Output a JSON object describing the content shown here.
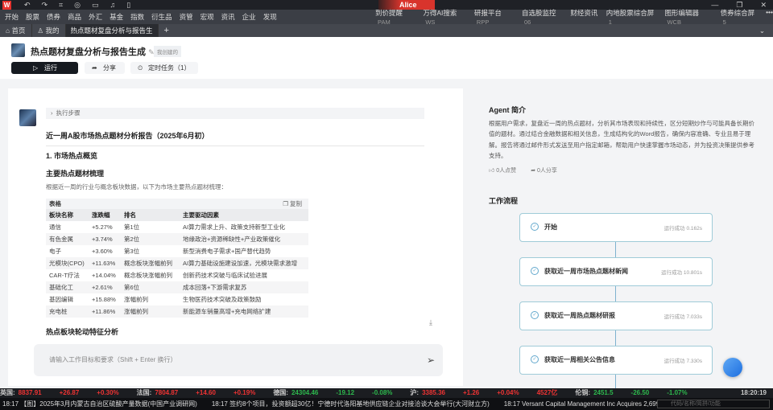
{
  "titlebar": {
    "logo": "W",
    "user": "Alice",
    "icons": [
      "undo-icon",
      "redo-icon",
      "crop-icon",
      "chat-icon",
      "monitor-icon",
      "bell-icon",
      "clipboard-icon"
    ]
  },
  "menu": {
    "left": [
      "开始",
      "股票",
      "债券",
      "商品",
      "外汇",
      "基金",
      "指数",
      "衍生品",
      "资管",
      "宏观",
      "资讯",
      "企业",
      "发现"
    ],
    "right": [
      {
        "label": "到价提醒",
        "code": "PAM"
      },
      {
        "label": "万得AI搜索",
        "code": "WS"
      },
      {
        "label": "研报平台",
        "code": "RPP"
      },
      {
        "label": "自选股监控",
        "code": "06"
      },
      {
        "label": "财经资讯",
        "code": ""
      },
      {
        "label": "内地股票综合屏",
        "code": "1"
      },
      {
        "label": "图形编辑器",
        "code": "WCB"
      },
      {
        "label": "债券综合屏",
        "code": "5"
      }
    ],
    "more": "•••"
  },
  "tabs": [
    {
      "label": "首页"
    },
    {
      "label": "我的"
    },
    {
      "label": "热点题材复盘分析与报告生"
    }
  ],
  "header": {
    "title": "热点题材复盘分析与报告生成",
    "badge": "我创建的",
    "run": "运行",
    "share": "分享",
    "schedule": "定时任务（1）"
  },
  "chat": {
    "steps": "执行步骤",
    "report_title": "近一周A股市场热点题材分析报告（2025年6月初）",
    "section1": "1. 市场热点概览",
    "sub1": "主要热点题材梳理",
    "intro": "根据近一周的行业与概念板块数据，以下为市场主要热点题材梳理：",
    "table": {
      "label": "表格",
      "copy": "复制",
      "headers": [
        "板块名称",
        "涨跌幅",
        "排名",
        "主要驱动因素"
      ],
      "rows": [
        [
          "通信",
          "+5.27%",
          "第1位",
          "AI算力需求上升、政策支持新型工业化"
        ],
        [
          "有色金属",
          "+3.74%",
          "第2位",
          "地缘政治+资源稀缺性+产业政策催化"
        ],
        [
          "电子",
          "+3.60%",
          "第3位",
          "新型消费电子需求+国产替代趋势"
        ],
        [
          "光模块(CPO)",
          "+11.63%",
          "概念板块涨幅前列",
          "AI算力基础设施建设加速，光模块需求激增"
        ],
        [
          "CAR-T疗法",
          "+14.04%",
          "概念板块涨幅前列",
          "创新药技术突破与临床试验进展"
        ],
        [
          "基础化工",
          "+2.61%",
          "第6位",
          "成本回落+下游需求复苏"
        ],
        [
          "基因编辑",
          "+15.88%",
          "涨幅前列",
          "生物医药技术突破及政策鼓励"
        ],
        [
          "充电桩",
          "+11.86%",
          "涨幅前列",
          "新能源车销量高增+充电网络扩建"
        ]
      ]
    },
    "sub2": "热点板块轮动特征分析",
    "input_placeholder": "请输入工作目标和要求（Shift + Enter 换行）"
  },
  "agent": {
    "title": "Agent 简介",
    "description": "根据用户需求，复盘近一周的热点题材，分析其市场表现和持续性，区分短期炒作与可能具备长期价值的题材。通过结合金融数据和相关信息，生成结构化的Word报告，确保内容准确、专业且易于理解。报告将通过邮件形式发送至用户指定邮箱，帮助用户快速掌握市场动态，并为投资决策提供参考支持。",
    "likes": "0人点赞",
    "shares": "0人分享"
  },
  "workflow": {
    "title": "工作流程",
    "nodes": [
      {
        "name": "开始",
        "status": "运行成功 0.162s"
      },
      {
        "name": "获取近一周市场热点题材新闻",
        "status": "运行成功 10.801s"
      },
      {
        "name": "获取近一周热点题材研报",
        "status": "运行成功 7.033s"
      },
      {
        "name": "获取近一周相关公告信息",
        "status": "运行成功 7.330s"
      }
    ]
  },
  "ticker": [
    {
      "name": "英国:",
      "value": "8837.91",
      "chg": "+26.87",
      "pct": "+0.30%",
      "dir": "up"
    },
    {
      "name": "法国:",
      "value": "7804.87",
      "chg": "+14.60",
      "pct": "+0.19%",
      "dir": "up"
    },
    {
      "name": "德国:",
      "value": "24304.46",
      "chg": "-19.12",
      "pct": "-0.08%",
      "dir": "dn"
    },
    {
      "name": "沪:",
      "value": "3385.36",
      "chg": "+1.26",
      "pct": "+0.04%",
      "extra": "4527亿",
      "dir": "up"
    },
    {
      "name": "伦铜:",
      "value": "2451.5",
      "chg": "-26.50",
      "pct": "-1.07%",
      "dir": "dn"
    }
  ],
  "clock": "18:20:19",
  "news": [
    "18:17 【图】2025年3月内蒙古自治区硫酸产量数据(中国产业调研网)",
    "18:17 签约8个项目，投资额超30亿！宁德时代洛阳基地供应链企业对接洽谈大会举行(大河财立方)",
    "18:17 Versant Capital Management Inc Acquires 2,699 ..."
  ],
  "search_placeholder": "代码/名称/简拼/功能",
  "colors": {
    "up": "#e33333",
    "down": "#2db84d",
    "accent": "#1e6fe0"
  }
}
